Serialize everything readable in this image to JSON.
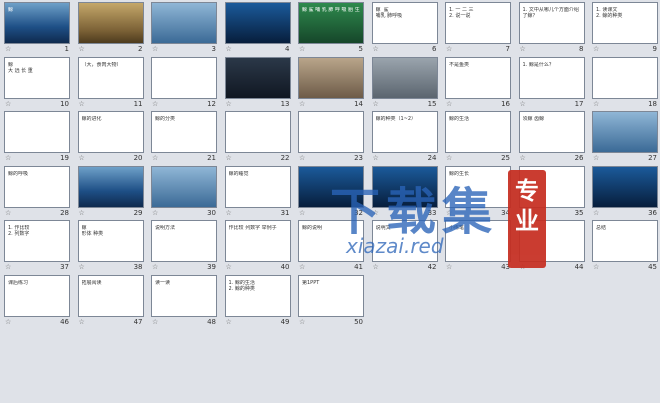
{
  "slides": [
    {
      "n": "1",
      "style": "ocean",
      "text": "鲸"
    },
    {
      "n": "2",
      "style": "savanna",
      "text": ""
    },
    {
      "n": "3",
      "style": "sea2",
      "text": ""
    },
    {
      "n": "4",
      "style": "deep",
      "text": ""
    },
    {
      "n": "5",
      "style": "green",
      "text": "鲸 鲨 哺 乳 肺 呼 吸 胎 生"
    },
    {
      "n": "6",
      "style": "white",
      "text": "鲸  鲨\n哺乳 肺呼吸"
    },
    {
      "n": "7",
      "style": "white",
      "text": "1. 一 二 三\n2. 说一说"
    },
    {
      "n": "8",
      "style": "white",
      "text": "1. 文中从哪几个方面介绍了鲸？"
    },
    {
      "n": "9",
      "style": "white",
      "text": "1. 读课文\n2. 鲸的种类"
    },
    {
      "n": "10",
      "style": "white",
      "text": "鲸\n大 远 长 重"
    },
    {
      "n": "11",
      "style": "white",
      "text": "（大，食肉大物）"
    },
    {
      "n": "12",
      "style": "white",
      "text": ""
    },
    {
      "n": "13",
      "style": "dark",
      "text": ""
    },
    {
      "n": "14",
      "style": "sand",
      "text": ""
    },
    {
      "n": "15",
      "style": "grey",
      "text": ""
    },
    {
      "n": "16",
      "style": "white",
      "text": "不是鱼类"
    },
    {
      "n": "17",
      "style": "white",
      "text": "1. 鲸是什么？"
    },
    {
      "n": "18",
      "style": "white",
      "text": ""
    },
    {
      "n": "19",
      "style": "white",
      "text": ""
    },
    {
      "n": "20",
      "style": "white",
      "text": "鲸的进化"
    },
    {
      "n": "21",
      "style": "white",
      "text": "鲸的分类"
    },
    {
      "n": "22",
      "style": "white",
      "text": ""
    },
    {
      "n": "23",
      "style": "white",
      "text": ""
    },
    {
      "n": "24",
      "style": "white",
      "text": "鲸的种类（1~2）"
    },
    {
      "n": "25",
      "style": "white",
      "text": "鲸的生活"
    },
    {
      "n": "26",
      "style": "white",
      "text": "须鲸 齿鲸"
    },
    {
      "n": "27",
      "style": "sea2",
      "text": ""
    },
    {
      "n": "28",
      "style": "white",
      "text": "鲸的呼吸"
    },
    {
      "n": "29",
      "style": "ocean",
      "text": ""
    },
    {
      "n": "30",
      "style": "sea2",
      "text": ""
    },
    {
      "n": "31",
      "style": "white",
      "text": "鲸的睡觉"
    },
    {
      "n": "32",
      "style": "deep",
      "text": ""
    },
    {
      "n": "33",
      "style": "deep",
      "text": ""
    },
    {
      "n": "34",
      "style": "white",
      "text": "鲸的生长"
    },
    {
      "n": "35",
      "style": "white",
      "text": ""
    },
    {
      "n": "36",
      "style": "deep",
      "text": ""
    },
    {
      "n": "37",
      "style": "white",
      "text": "1. 作比较\n2. 列数字"
    },
    {
      "n": "38",
      "style": "white",
      "text": "鲸\n形体 种类"
    },
    {
      "n": "39",
      "style": "white",
      "text": "说明方法"
    },
    {
      "n": "40",
      "style": "white",
      "text": "作比较 列数字 举例子"
    },
    {
      "n": "41",
      "style": "white",
      "text": "鲸的说明"
    },
    {
      "n": "42",
      "style": "white",
      "text": "说明文"
    },
    {
      "n": "43",
      "style": "white",
      "text": "小练笔"
    },
    {
      "n": "44",
      "style": "white",
      "text": "作业"
    },
    {
      "n": "45",
      "style": "white",
      "text": "总结"
    },
    {
      "n": "46",
      "style": "white",
      "text": "课后练习"
    },
    {
      "n": "47",
      "style": "white",
      "text": "拓展阅读"
    },
    {
      "n": "48",
      "style": "white",
      "text": "读一读"
    },
    {
      "n": "49",
      "style": "white",
      "text": "1. 鲸的生活\n2. 鲸的种类"
    },
    {
      "n": "50",
      "style": "white",
      "text": "第1PPT"
    }
  ],
  "watermark": {
    "title": "下载集",
    "badge": "专业",
    "url": "xiazai.red"
  }
}
